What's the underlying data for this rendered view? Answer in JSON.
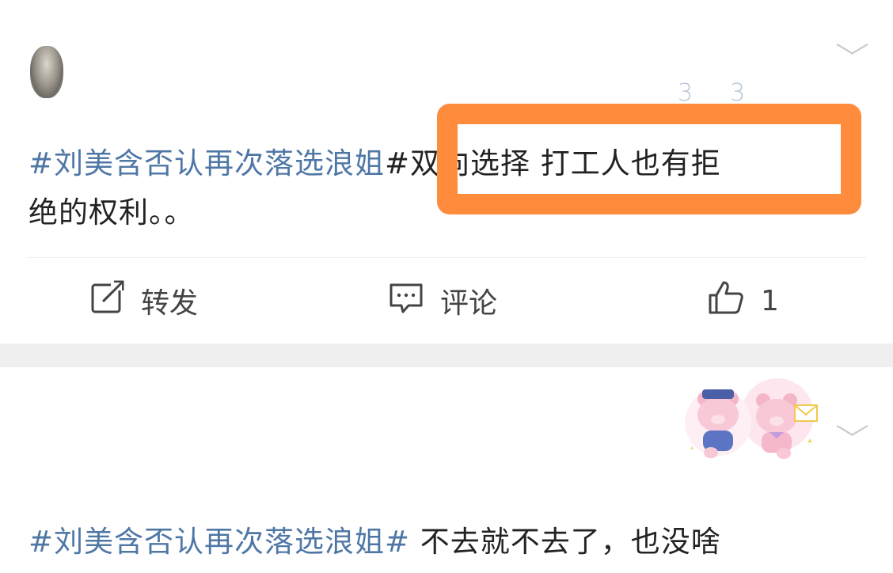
{
  "post1": {
    "hashtag": "#刘美含否认再次落选浪姐",
    "text_line1": "#双向选择 打工人也有拒",
    "text_line2": "绝的权利。。",
    "faint_numbers": [
      "3",
      "3"
    ],
    "actions": {
      "repost_label": "转发",
      "comment_label": "评论",
      "like_count": "1"
    }
  },
  "post2": {
    "hashtag": "#刘美含否认再次落选浪姐#",
    "text": " 不去就不去了，也没啥"
  },
  "colors": {
    "hashtag": "#4f77a6",
    "highlight": "#ff8b3d",
    "separator": "#efefef"
  },
  "icons": [
    "chevron-down-icon",
    "repost-icon",
    "comment-icon",
    "like-icon"
  ]
}
